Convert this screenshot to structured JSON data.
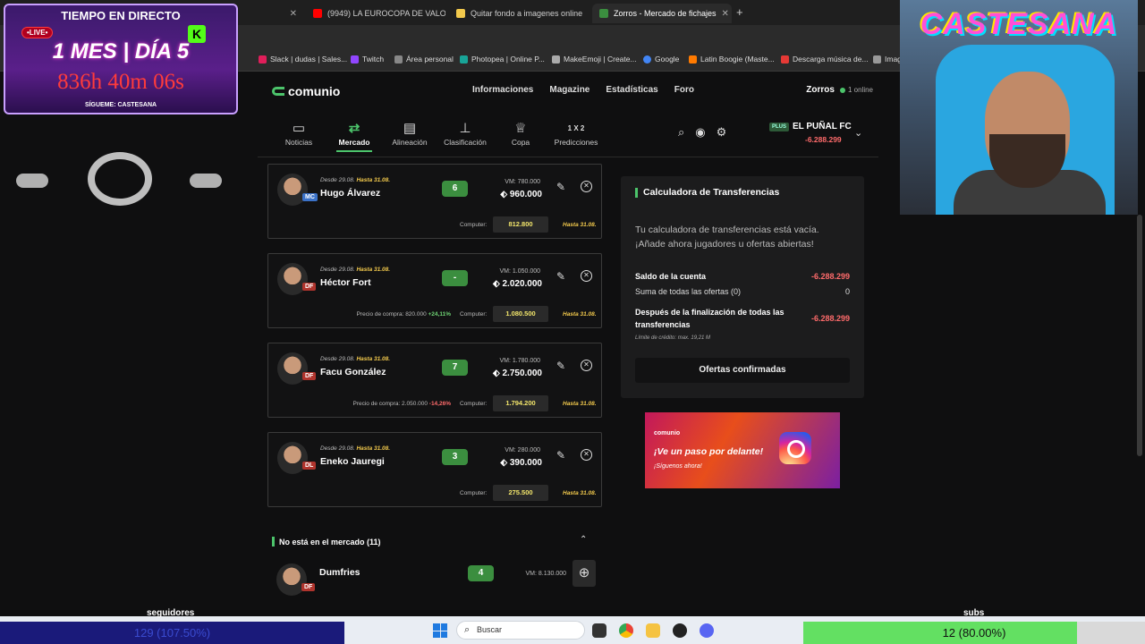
{
  "browser": {
    "tabs": [
      {
        "title": "(9949) LA EUROCOPA DE VALO",
        "color": "#ff0000"
      },
      {
        "title": "Quitar fondo a imagenes online",
        "color": "#f2c94c"
      },
      {
        "title": "Zorros - Mercado de fichajes",
        "color": "#3b8e3f",
        "active": true
      }
    ],
    "bookmarks": [
      {
        "label": "Slack | dudas | Sales...",
        "color": "#e01e5a"
      },
      {
        "label": "Twitch",
        "color": "#9146ff"
      },
      {
        "label": "Área personal",
        "color": "#888888"
      },
      {
        "label": "Photopea | Online P...",
        "color": "#18a497"
      },
      {
        "label": "MakeEmoji | Create...",
        "color": "#aaaaaa"
      },
      {
        "label": "Google",
        "color": "#4285f4"
      },
      {
        "label": "Latin Boogie (Maste...",
        "color": "#ff7a00"
      },
      {
        "label": "Descarga música de...",
        "color": "#e53935"
      },
      {
        "label": "Imag",
        "color": "#999999"
      }
    ]
  },
  "header": {
    "brand": "comunio",
    "links": [
      "Informaciones",
      "Magazine",
      "Estadísticas",
      "Foro"
    ],
    "league": "Zorros",
    "online": "1 online",
    "nav": [
      {
        "label": "Noticias",
        "icon": "tv-icon"
      },
      {
        "label": "Mercado",
        "icon": "transfer-icon",
        "active": true
      },
      {
        "label": "Alineación",
        "icon": "lineup-icon"
      },
      {
        "label": "Clasificación",
        "icon": "ranking-icon"
      },
      {
        "label": "Copa",
        "icon": "trophy-icon"
      },
      {
        "label": "Predicciones",
        "icon": "1x2-icon",
        "icon_text": "1 X 2"
      }
    ],
    "team": {
      "badge": "PLUS",
      "name": "EL PUÑAL FC",
      "balance": "-6.288.299"
    }
  },
  "offers": [
    {
      "since": "Desde 29.08.",
      "until": "Hasta 31.08.",
      "name": "Hugo Álvarez",
      "pos": "MC",
      "points": "6",
      "vm": "VM: 780.000",
      "bid": "960.000",
      "buy_label": "",
      "buy_pct": "",
      "buy_pct_sign": "",
      "computer_label": "Computer:",
      "computer": "812.800",
      "computer_until": "Hasta 31.08."
    },
    {
      "since": "Desde 29.08.",
      "until": "Hasta 31.08.",
      "name": "Héctor Fort",
      "pos": "DF",
      "points": "-",
      "vm": "VM: 1.050.000",
      "bid": "2.020.000",
      "buy_label": "Precio de compra: 820.000",
      "buy_pct": "+24,11%",
      "buy_pct_sign": "pos",
      "computer_label": "Computer:",
      "computer": "1.080.500",
      "computer_until": "Hasta 31.08."
    },
    {
      "since": "Desde 29.08.",
      "until": "Hasta 31.08.",
      "name": "Facu González",
      "pos": "DF",
      "points": "7",
      "vm": "VM: 1.780.000",
      "bid": "2.750.000",
      "buy_label": "Precio de compra: 2.050.000",
      "buy_pct": "-14,26%",
      "buy_pct_sign": "neg",
      "computer_label": "Computer:",
      "computer": "1.794.200",
      "computer_until": "Hasta 31.08."
    },
    {
      "since": "Desde 29.08.",
      "until": "Hasta 31.08.",
      "name": "Eneko Jauregi",
      "pos": "DL",
      "points": "3",
      "vm": "VM: 280.000",
      "bid": "390.000",
      "buy_label": "",
      "buy_pct": "",
      "buy_pct_sign": "",
      "computer_label": "Computer:",
      "computer": "275.500",
      "computer_until": "Hasta 31.08."
    }
  ],
  "not_in_market": {
    "title": "No está en el mercado (11)",
    "first": {
      "name": "Dumfries",
      "pos": "DF",
      "points": "4",
      "vm": "VM: 8.130.000"
    }
  },
  "calculator": {
    "title": "Calculadora de Transferencias",
    "empty": "Tu calculadora de transferencias está vacía. ¡Añade ahora jugadores u ofertas abiertas!",
    "balance_label": "Saldo de la cuenta",
    "balance": "-6.288.299",
    "sum_label": "Suma de todas las ofertas (0)",
    "sum": "0",
    "after_label": "Después de la finalización de todas las transferencias",
    "after": "-6.288.299",
    "credit": "Límite de crédito: max. 19,21 M",
    "confirm": "Ofertas confirmadas"
  },
  "promo": {
    "brand": "comunio",
    "line1": "¡Ve un paso por delante!",
    "line2": "¡Síguenos ahora!"
  },
  "stream": {
    "title": "TIEMPO EN DIRECTO",
    "live": "•LIVE•",
    "day": "1 MES | DÍA 5",
    "counter": "836h 40m 06s",
    "follow": "SÍGUEME: CASTESANA",
    "channel_logo": "CASTESANA",
    "followers_label": "seguidores",
    "followers": "129 (107.50%)",
    "followers_pct": 100,
    "subs_label": "subs",
    "subs": "12 (80.00%)",
    "subs_pct": 80
  },
  "taskbar": {
    "search": "Buscar"
  }
}
